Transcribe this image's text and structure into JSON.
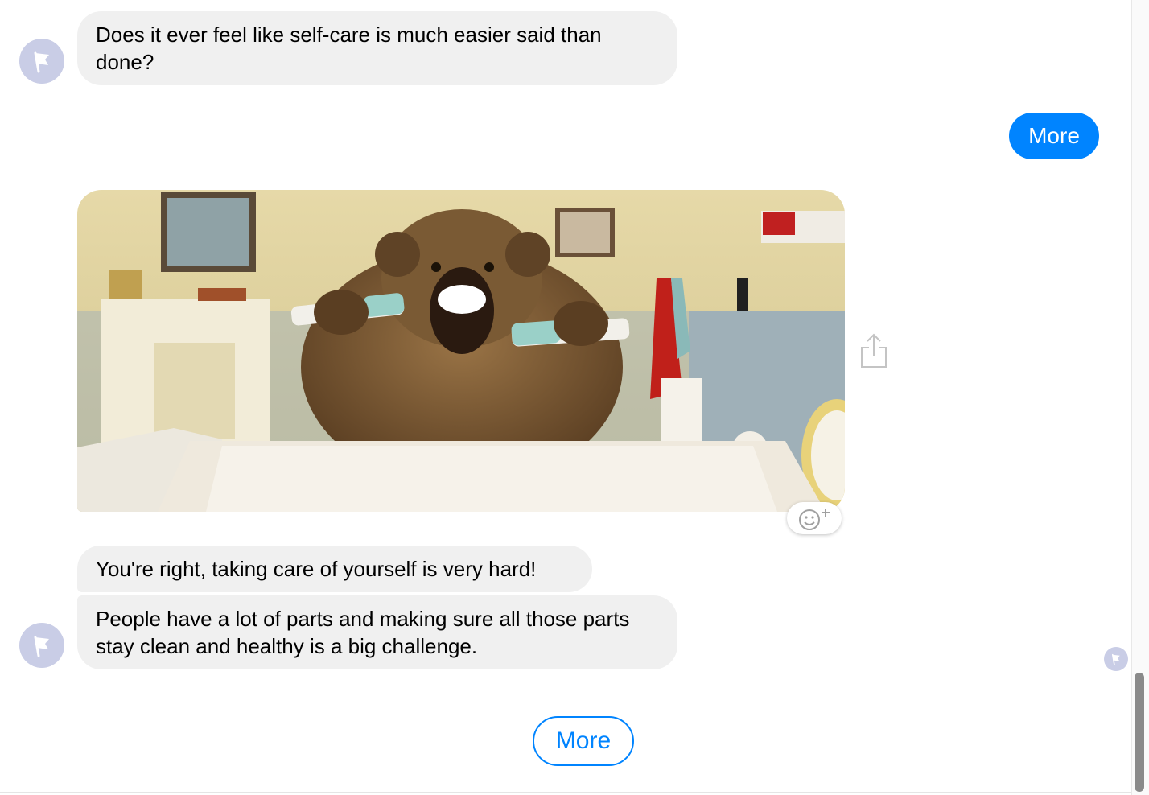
{
  "messages": {
    "m1": "Does it ever feel like self-care is much easier said than done?",
    "m2": "You're right, taking care of yourself is very hard!",
    "m3": "People have a lot of parts and making sure all those parts stay clean and healthy is a big challenge."
  },
  "sent": {
    "more_label": "More"
  },
  "quick_reply": {
    "more_label": "More"
  },
  "icons": {
    "avatar": "flag-icon",
    "share": "share-icon",
    "reaction": "add-reaction-icon",
    "read_receipt": "flag-icon"
  },
  "colors": {
    "accent": "#0084ff",
    "bubble_received": "#f0f0f0",
    "avatar_bg": "#c9cde6"
  }
}
